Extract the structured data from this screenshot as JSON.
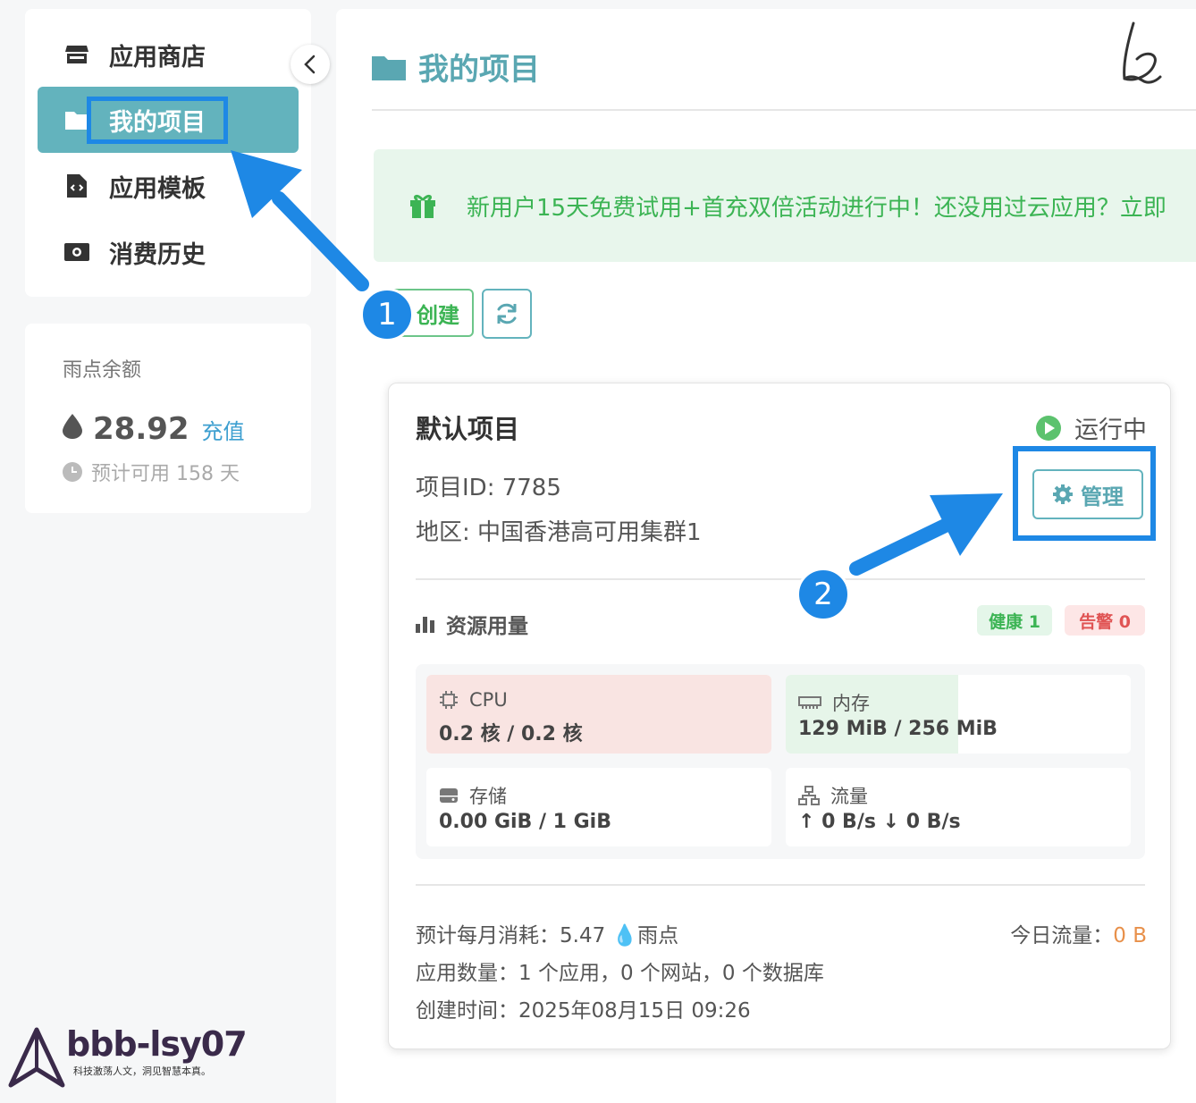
{
  "sidebar": {
    "items": [
      {
        "label": "应用商店",
        "icon": "store-icon"
      },
      {
        "label": "我的项目",
        "icon": "folder-icon"
      },
      {
        "label": "应用模板",
        "icon": "file-code-icon"
      },
      {
        "label": "消费历史",
        "icon": "money-icon"
      }
    ],
    "active_index": 1
  },
  "balance": {
    "title": "雨点余额",
    "amount": "28.92",
    "recharge_label": "充值",
    "estimate": "预计可用 158 天"
  },
  "watermark": {
    "name": "bbb-lsy07",
    "slogan": "科技激荡人文，洞见智慧本真。"
  },
  "header": {
    "title": "我的项目"
  },
  "promo": {
    "text": "新用户15天免费试用+首充双倍活动进行中！还没用过云应用？立即"
  },
  "toolbar": {
    "create_label": "创建"
  },
  "project": {
    "name": "默认项目",
    "status": "运行中",
    "id_line": "项目ID: 7785",
    "region_line": "地区: 中国香港高可用集群1",
    "manage_label": "管理",
    "resources_title": "资源用量",
    "healthy_tag": "健康 1",
    "alert_tag": "告警 0",
    "resources": {
      "cpu": {
        "label": "CPU",
        "value": "0.2 核 / 0.2 核",
        "usage_pct": 100
      },
      "memory": {
        "label": "内存",
        "value": "129 MiB / 256 MiB",
        "usage_pct": 50
      },
      "storage": {
        "label": "存储",
        "value": "0.00 GiB / 1 GiB",
        "usage_pct": 0
      },
      "traffic": {
        "label": "流量",
        "value": "↑ 0 B/s ↓ 0 B/s"
      }
    },
    "monthly_cost": "预计每月消耗：5.47 💧雨点",
    "today_traffic_label": "今日流量：",
    "today_traffic_value": "0 B",
    "app_count": "应用数量：1 个应用，0 个网站，0 个数据库",
    "created_at": "创建时间：2025年08月15日 09:26"
  },
  "annotations": {
    "step1": "1",
    "step2": "2"
  },
  "colors": {
    "accent": "#63b3bd",
    "annotation": "#1e88e5",
    "success": "#3cb454",
    "danger": "#e05454",
    "cpu_fill": "#f9e4e2",
    "mem_fill": "#e6f5e9"
  }
}
